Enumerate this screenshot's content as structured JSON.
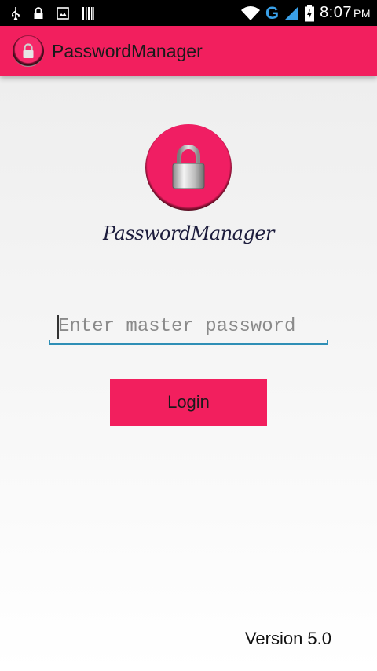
{
  "status_bar": {
    "time": "8:07",
    "ampm": "PM",
    "network_type": "G",
    "icons": [
      "usb-icon",
      "lock-icon",
      "image-icon",
      "barcode-icon",
      "wifi-icon",
      "signal-icon",
      "battery-charging-icon"
    ]
  },
  "app_bar": {
    "title": "PasswordManager",
    "background_color": "#f21f5e"
  },
  "brand": {
    "logo_icon": "padlock-icon",
    "text": "PasswordManager"
  },
  "login_form": {
    "password_placeholder": "Enter master password",
    "password_value": "",
    "login_label": "Login",
    "accent_color": "#2f8fb6"
  },
  "footer": {
    "version": "Version 5.0"
  }
}
